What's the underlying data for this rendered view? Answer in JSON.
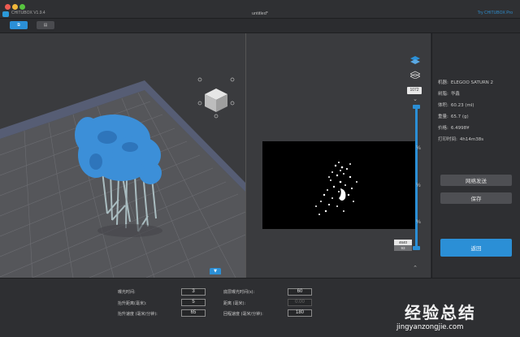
{
  "titlebar": {
    "app_name": "CHITUBOX V1.9.4",
    "doc_title": "untitled*",
    "promo_link": "Try CHITUBOX Pro",
    "traffic_colors": [
      "#ee5b52",
      "#f0b73a",
      "#57c43f"
    ]
  },
  "toolbar": {
    "buttons": [
      {
        "icon": "layers-view-icon",
        "active": true
      },
      {
        "icon": "slice-view-icon",
        "active": false
      }
    ]
  },
  "viewport": {
    "view_cube": {
      "icon": "view-cube-icon"
    },
    "collapse_icon": "chevron-down-icon"
  },
  "slice_preview": {
    "layer_value": "1072",
    "slider": {
      "ticks": [
        "¼",
        "½",
        "¾"
      ],
      "current_layer": "4640",
      "min_layer": "93",
      "position_fraction": 0.97
    }
  },
  "info": {
    "rows": [
      {
        "label": "机器:",
        "value": "ELEGOO SATURN 2"
      },
      {
        "label": "树脂:",
        "value": "华鑫"
      },
      {
        "label": "体积:",
        "value": "60.23  (ml)"
      },
      {
        "label": "重量:",
        "value": "65.7  (g)"
      },
      {
        "label": "价格:",
        "value": "6.4998¥"
      },
      {
        "label": "打印时间:",
        "value": "4h14m38s"
      }
    ],
    "network_send": "网络发送",
    "save": "保存",
    "back": "返回"
  },
  "params": {
    "left": [
      {
        "label": "曝光时间:",
        "value": "3",
        "disabled": false
      },
      {
        "label": "抬升距离(毫米):",
        "value": "5",
        "disabled": false
      },
      {
        "label": "抬升速度 (毫米/分钟):",
        "value": "65",
        "disabled": false
      }
    ],
    "right": [
      {
        "label": "底层曝光时间(s):",
        "value": "60",
        "disabled": false
      },
      {
        "label": "距离 (毫米):",
        "value": "0.00",
        "disabled": true
      },
      {
        "label": "回程速度 (毫米/分钟):",
        "value": "180",
        "disabled": false
      }
    ]
  },
  "watermark": {
    "brand": "经验总结",
    "url": "jingyanzongjie.com"
  },
  "colors": {
    "accent": "#2b8fd6",
    "model": "#3c8fd8",
    "supports": "#9fb4b8"
  }
}
